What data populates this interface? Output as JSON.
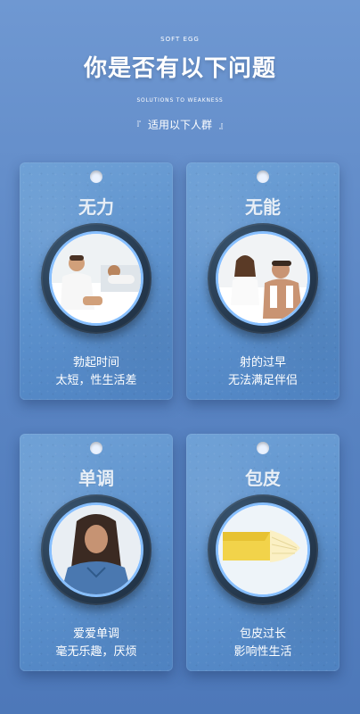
{
  "header": {
    "eyebrow": "SOFT EGG",
    "title": "你是否有以下问题",
    "subtitle": "SOLUTIONS TO WEAKNESS",
    "audience": "适用以下人群",
    "bracket_left": "『",
    "bracket_right": "』"
  },
  "cards": [
    {
      "title": "无力",
      "line1": "勃起时间",
      "line2": "太短，性生活差",
      "image": "couple-in-bed-illustration"
    },
    {
      "title": "无能",
      "line1": "射的过早",
      "line2": "无法满足伴侣",
      "image": "frustrated-man-illustration"
    },
    {
      "title": "单调",
      "line1": "爱爱单调",
      "line2": "毫无乐趣，厌烦",
      "image": "bored-woman-illustration"
    },
    {
      "title": "包皮",
      "line1": "包皮过长",
      "line2": "影响性生活",
      "image": "peeled-banana-illustration"
    }
  ],
  "colors": {
    "background_top": "#6f98d2",
    "card": "#5b90cc",
    "ring": "#25384d",
    "ring_border": "#87bfff"
  }
}
